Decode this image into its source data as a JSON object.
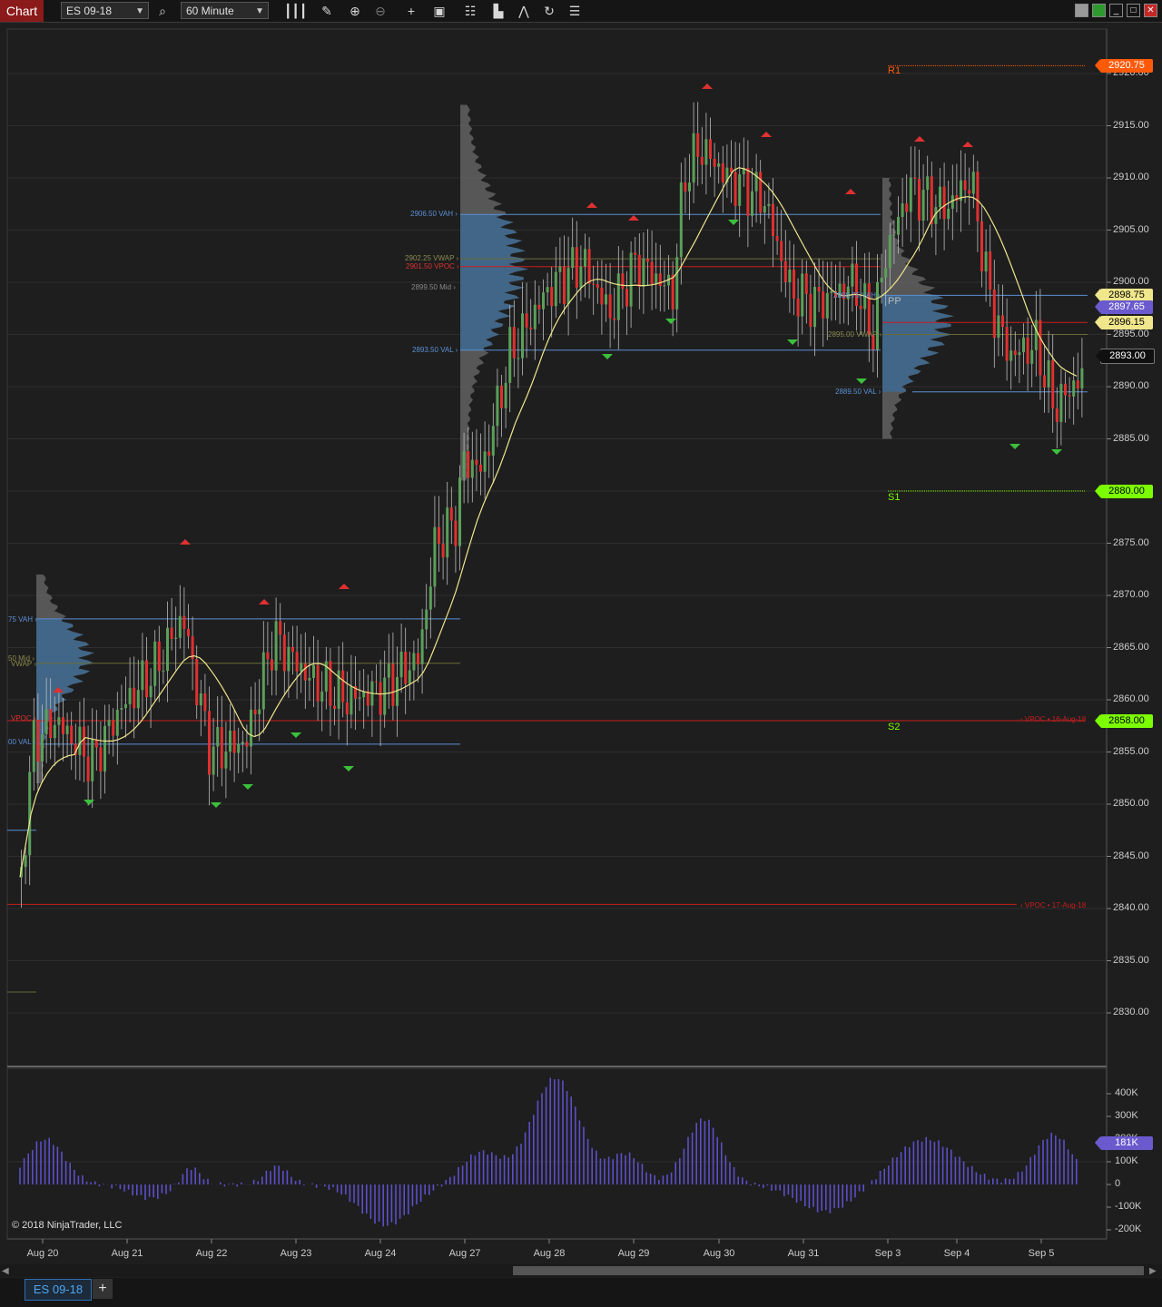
{
  "toolbar": {
    "chart_label": "Chart",
    "instrument": "ES 09-18",
    "interval": "60 Minute",
    "icons": [
      "search-icon",
      "bars-type-icon",
      "pencil-draw-icon",
      "zoom-in-icon",
      "zoom-out-icon",
      "crosshair-icon",
      "data-box-icon",
      "strategies-icon",
      "indicators-icon",
      "drawing-tools-icon",
      "reload-icon",
      "properties-icon"
    ]
  },
  "window_controls": [
    "minimize-icon",
    "maximize-icon",
    "close-icon"
  ],
  "price_axis": {
    "ticks": [
      "2920.00",
      "2915.00",
      "2910.00",
      "2905.00",
      "2900.00",
      "2895.00",
      "2890.00",
      "2885.00",
      "2880.00",
      "2875.00",
      "2870.00",
      "2865.00",
      "2860.00",
      "2855.00",
      "2850.00",
      "2845.00",
      "2840.00",
      "2835.00",
      "2830.00"
    ]
  },
  "price_tags": [
    {
      "label": "2920.75",
      "color": "#ff5a0a",
      "text": "#ffffff"
    },
    {
      "label": "2898.75",
      "color": "#f0e68c",
      "text": "#000000"
    },
    {
      "label": "2897.65",
      "color": "#6a5acd",
      "text": "#ffffff"
    },
    {
      "label": "2896.15",
      "color": "#f0e68c",
      "text": "#000000"
    },
    {
      "label": "2893.00",
      "color": "#101010",
      "text": "#ffffff"
    },
    {
      "label": "2880.00",
      "color": "#7cfc00",
      "text": "#000000"
    },
    {
      "label": "2858.00",
      "color": "#7cfc00",
      "text": "#000000"
    }
  ],
  "pivots": {
    "r1": "R1",
    "pp": "PP",
    "s1": "S1",
    "s2": "S2"
  },
  "annotations": {
    "vah1": "2906.50 VAH ›",
    "vwap1": "2902.25 VWAP ›",
    "vpoc1": "2901.50 VPOC ›",
    "mid1": "2899.50 Mid ›",
    "val1": "2893.50 VAL ›",
    "vah_left": "75 VAH ›",
    "mid_left": "50 Mid ›",
    "vwap_left": "VWAP ›",
    "vpoc_left": "VPOC ›",
    "val_left": "00 VAL ›",
    "vah_sep": "2898.75 VAH ›",
    "vwap_sep": "2895.00 VWAP ›",
    "val_sep": "2889.50 VAL ›",
    "vpoc_ref1": "‹ VPOC • 16-Aug-18",
    "vpoc_ref2": "‹ VPOC • 17-Aug-18"
  },
  "volume_axis": {
    "ticks": [
      "400K",
      "300K",
      "200K",
      "100K",
      "0",
      "-100K",
      "-200K"
    ],
    "current_tag": "181K",
    "current_color": "#6a5acd"
  },
  "date_axis": [
    "Aug 20",
    "Aug 21",
    "Aug 22",
    "Aug 23",
    "Aug 24",
    "Aug 27",
    "Aug 28",
    "Aug 29",
    "Aug 30",
    "Aug 31",
    "Sep 3",
    "Sep 4",
    "Sep 5"
  ],
  "copyright": "© 2018 NinjaTrader, LLC",
  "tabs": {
    "active": "ES 09-18",
    "add": "+"
  },
  "colors": {
    "up": "#5aa05a",
    "down": "#e03030",
    "vwap_line": "#f0e68c",
    "ma_dotted": "#6a5acd",
    "vah_val": "#5b8fd4",
    "vpoc": "#c81e1e"
  }
}
